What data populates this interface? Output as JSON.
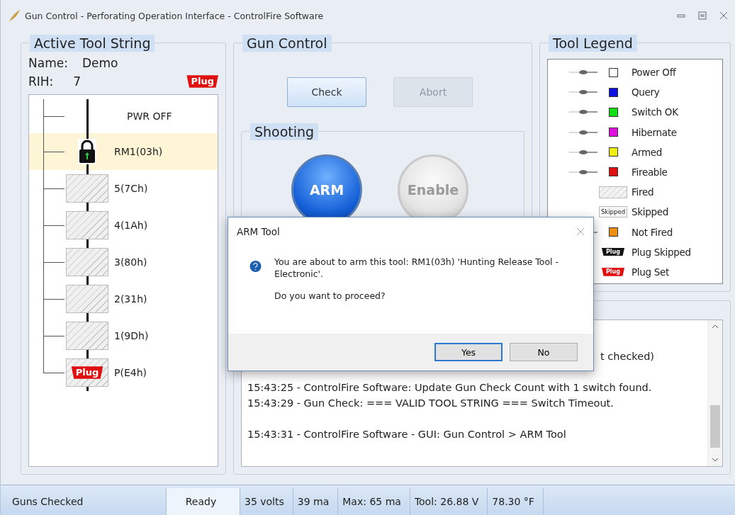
{
  "window": {
    "title": "Gun Control - Perforating Operation Interface - ControlFire Software"
  },
  "tool_string": {
    "title": "Active Tool String",
    "name_label": "Name:",
    "name": "Demo",
    "rih_label": "RIH:",
    "rih": "7",
    "badge": "Plug",
    "nodes": [
      {
        "label": "PWR OFF",
        "kind": "header",
        "selected": false
      },
      {
        "label": "RM1(03h)",
        "kind": "lock",
        "selected": true
      },
      {
        "label": "5(7Ch)",
        "kind": "fired",
        "selected": false
      },
      {
        "label": "4(1Ah)",
        "kind": "fired",
        "selected": false
      },
      {
        "label": "3(80h)",
        "kind": "fired",
        "selected": false
      },
      {
        "label": "2(31h)",
        "kind": "fired",
        "selected": false
      },
      {
        "label": "1(9Dh)",
        "kind": "fired",
        "selected": false
      },
      {
        "label": "P(E4h)",
        "kind": "plug",
        "badge": "Plug",
        "selected": false
      }
    ]
  },
  "gun_control": {
    "title": "Gun Control",
    "buttons": [
      {
        "label": "Check",
        "disabled": false
      },
      {
        "label": "Abort",
        "disabled": true
      }
    ],
    "shooting": {
      "title": "Shooting",
      "buttons": [
        {
          "label": "ARM",
          "disabled": false
        },
        {
          "label": "Enable",
          "disabled": true
        }
      ]
    }
  },
  "legend": {
    "title": "Tool Legend",
    "items": [
      {
        "label": "Power Off",
        "kind": "switch",
        "color": "#ffffff"
      },
      {
        "label": "Query",
        "kind": "switch",
        "color": "#1010e0"
      },
      {
        "label": "Switch OK",
        "kind": "switch",
        "color": "#10e010"
      },
      {
        "label": "Hibernate",
        "kind": "switch",
        "color": "#e010e0"
      },
      {
        "label": "Armed",
        "kind": "switch",
        "color": "#f0f010"
      },
      {
        "label": "Fireable",
        "kind": "switch",
        "color": "#e01010"
      },
      {
        "label": "Fired",
        "kind": "fired"
      },
      {
        "label": "Skipped",
        "kind": "skipped",
        "badge": "Skipped"
      },
      {
        "label": "Not Fired",
        "kind": "switch",
        "color": "#f09010"
      },
      {
        "label": "Plug Skipped",
        "kind": "plug",
        "color": "#111111",
        "badge": "Plug"
      },
      {
        "label": "Plug Set",
        "kind": "plug",
        "color": "#e01010",
        "badge": "Plug"
      }
    ]
  },
  "log": {
    "lines": [
      {
        "text": "t checked)",
        "cut_left": true
      },
      {
        "text": "15:43:25 - ControlFire Software: Update Gun Check Count with 1 switch found.",
        "cut_left": false
      },
      {
        "text": "15:43:29 - Gun Check: === VALID TOOL STRING ===  Switch Timeout.",
        "cut_left": false
      },
      {
        "text": "15:43:31 - ControlFire Software - GUI: Gun Control > ARM Tool",
        "cut_left": false
      }
    ]
  },
  "dialog": {
    "title": "ARM Tool",
    "message": "You are about to arm this tool: RM1(03h) 'Hunting Release Tool - Electronic'.",
    "question": "Do you want to proceed?",
    "buttons": [
      {
        "label": "Yes",
        "selected": true
      },
      {
        "label": "No",
        "selected": false
      }
    ]
  },
  "status_bar": [
    {
      "text": "Guns Checked",
      "kind": "wide"
    },
    {
      "text": "Ready",
      "kind": "highlight"
    },
    {
      "text": "35 volts",
      "kind": "plain"
    },
    {
      "text": "39 ma",
      "kind": "plain"
    },
    {
      "text": "Max: 65 ma",
      "kind": "plain"
    },
    {
      "text": "Tool: 26.88 V",
      "kind": "plain"
    },
    {
      "text": "78.30 °F",
      "kind": "plain"
    }
  ]
}
